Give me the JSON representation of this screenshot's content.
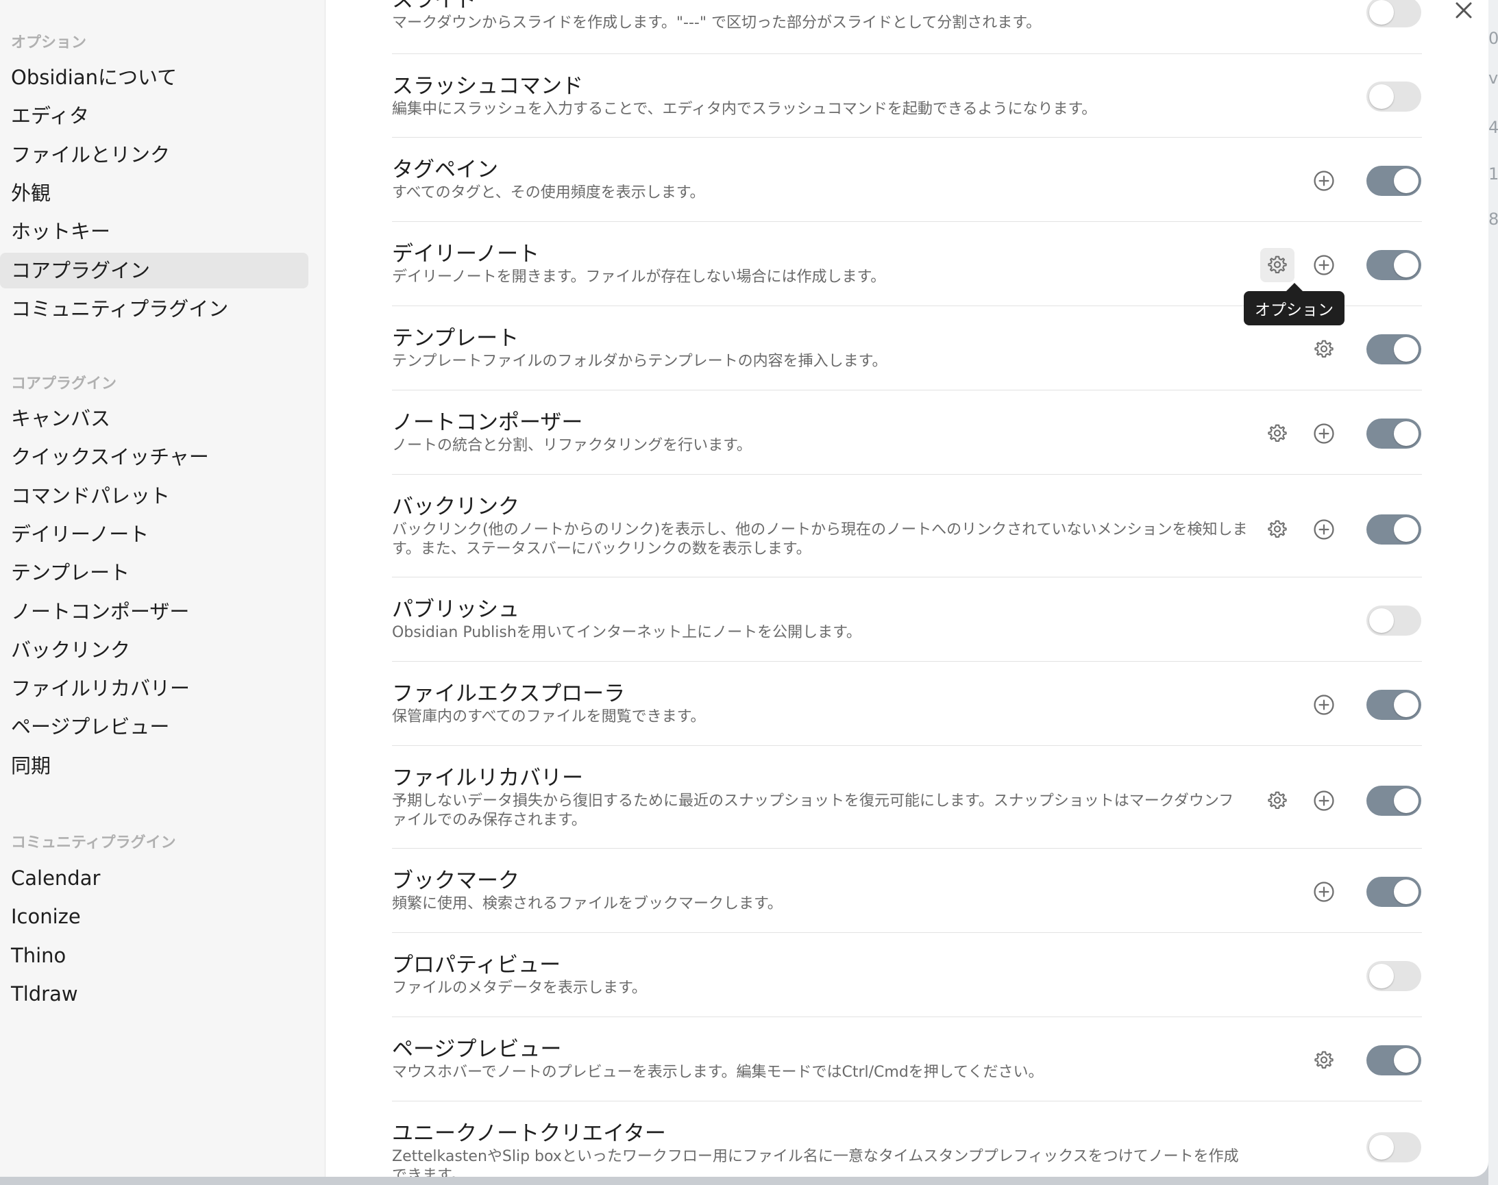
{
  "sidebar": {
    "options_heading": "オプション",
    "options_items": [
      {
        "label": "Obsidianについて"
      },
      {
        "label": "エディタ"
      },
      {
        "label": "ファイルとリンク"
      },
      {
        "label": "外観"
      },
      {
        "label": "ホットキー"
      },
      {
        "label": "コアプラグイン",
        "active": true
      },
      {
        "label": "コミュニティプラグイン"
      }
    ],
    "core_heading": "コアプラグイン",
    "core_items": [
      {
        "label": "キャンバス"
      },
      {
        "label": "クイックスイッチャー"
      },
      {
        "label": "コマンドパレット"
      },
      {
        "label": "デイリーノート"
      },
      {
        "label": "テンプレート"
      },
      {
        "label": "ノートコンポーザー"
      },
      {
        "label": "バックリンク"
      },
      {
        "label": "ファイルリカバリー"
      },
      {
        "label": "ページプレビュー"
      },
      {
        "label": "同期"
      }
    ],
    "community_heading": "コミュニティプラグイン",
    "community_items": [
      {
        "label": "Calendar"
      },
      {
        "label": "Iconize"
      },
      {
        "label": "Thino"
      },
      {
        "label": "Tldraw"
      }
    ]
  },
  "close_icon": "close-icon",
  "tooltip": "オプション",
  "plugins": [
    {
      "title": "スライド",
      "desc": "マークダウンからスライドを作成します。\"---\" で区切った部分がスライドとして分割されます。",
      "enabled": false,
      "gear": false,
      "plus": false
    },
    {
      "title": "スラッシュコマンド",
      "desc": "編集中にスラッシュを入力することで、エディタ内でスラッシュコマンドを起動できるようになります。",
      "enabled": false,
      "gear": false,
      "plus": false
    },
    {
      "title": "タグペイン",
      "desc": "すべてのタグと、その使用頻度を表示します。",
      "enabled": true,
      "gear": false,
      "plus": true
    },
    {
      "title": "デイリーノート",
      "desc": "デイリーノートを開きます。ファイルが存在しない場合には作成します。",
      "enabled": true,
      "gear": true,
      "plus": true
    },
    {
      "title": "テンプレート",
      "desc": "テンプレートファイルのフォルダからテンプレートの内容を挿入します。",
      "enabled": true,
      "gear": true,
      "plus": false
    },
    {
      "title": "ノートコンポーザー",
      "desc": "ノートの統合と分割、リファクタリングを行います。",
      "enabled": true,
      "gear": true,
      "plus": true
    },
    {
      "title": "バックリンク",
      "desc": "バックリンク(他のノートからのリンク)を表示し、他のノートから現在のノートへのリンクされていないメンションを検知します。また、ステータスバーにバックリンクの数を表示します。",
      "enabled": true,
      "gear": true,
      "plus": true
    },
    {
      "title": "パブリッシュ",
      "desc": "Obsidian Publishを用いてインターネット上にノートを公開します。",
      "enabled": false,
      "gear": false,
      "plus": false
    },
    {
      "title": "ファイルエクスプローラ",
      "desc": "保管庫内のすべてのファイルを閲覧できます。",
      "enabled": true,
      "gear": false,
      "plus": true
    },
    {
      "title": "ファイルリカバリー",
      "desc": "予期しないデータ損失から復旧するために最近のスナップショットを復元可能にします。スナップショットはマークダウンファイルでのみ保存されます。",
      "enabled": true,
      "gear": true,
      "plus": true
    },
    {
      "title": "ブックマーク",
      "desc": "頻繁に使用、検索されるファイルをブックマークします。",
      "enabled": true,
      "gear": false,
      "plus": true
    },
    {
      "title": "プロパティビュー",
      "desc": "ファイルのメタデータを表示します。",
      "enabled": false,
      "gear": false,
      "plus": false
    },
    {
      "title": "ページプレビュー",
      "desc": "マウスホバーでノートのプレビューを表示します。編集モードではCtrl/Cmdを押してください。",
      "enabled": true,
      "gear": true,
      "plus": false
    },
    {
      "title": "ユニークノートクリエイター",
      "desc": "ZettelkastenやSlip boxといったワークフロー用にファイル名に一意なタイムスタンププレフィックスをつけてノートを作成できます。",
      "enabled": false,
      "gear": false,
      "plus": false
    }
  ],
  "backdrop_glyphs": [
    "0",
    "v",
    "4",
    "1",
    "8"
  ]
}
